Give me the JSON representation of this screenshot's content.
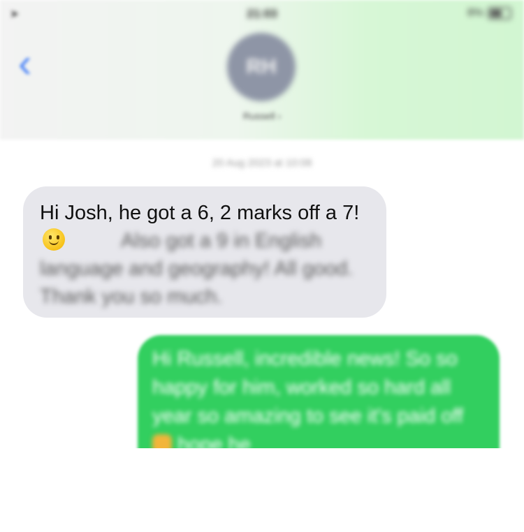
{
  "status_bar": {
    "left_glyph": "➤",
    "time": "21:03",
    "battery_label": "8%"
  },
  "header": {
    "back_glyph": "‹",
    "avatar_initials": "RH",
    "contact_name": "Russell ›"
  },
  "conversation": {
    "timestamp": "20 Aug 2023 at 10:08",
    "incoming": {
      "text_visible": "Hi Josh, he got a 6, 2 marks off a 7!",
      "text_blurred": "Also got a 9 in English language and geography! All good. Thank you so much."
    },
    "outgoing": {
      "text_part1": "Hi Russell, incredible news! So so happy for him, worked so hard all year so amazing to see it's paid off",
      "text_part2": "hope he"
    }
  },
  "colors": {
    "incoming_bubble": "#e7e7ec",
    "outgoing_bubble": "#32cf5f",
    "accent_blue": "#4f86f7",
    "avatar_bg": "#8e95a6"
  },
  "icons": {
    "back": "chevron-left-icon",
    "battery": "battery-icon",
    "location": "location-arrow-icon",
    "emoji_smile": "slightly-smiling-face-icon",
    "emoji_thumb": "thumbs-up-icon"
  }
}
